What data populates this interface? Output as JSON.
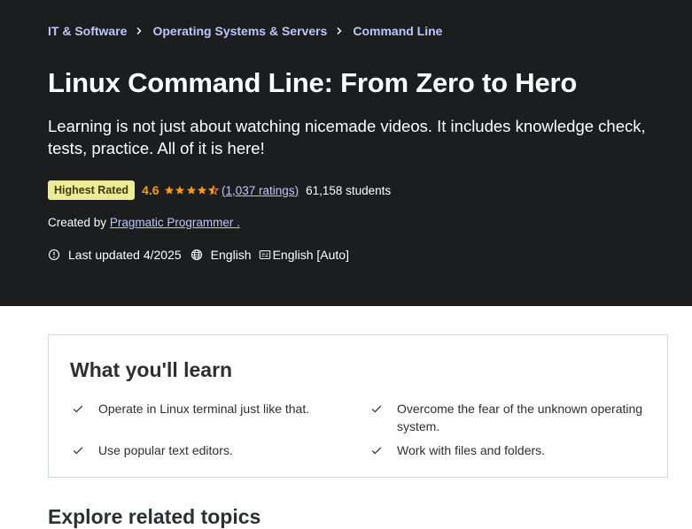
{
  "breadcrumb": [
    {
      "label": "IT & Software"
    },
    {
      "label": "Operating Systems & Servers"
    },
    {
      "label": "Command Line"
    }
  ],
  "course": {
    "title": "Linux Command Line: From Zero to Hero",
    "subtitle": "Learning is not just about watching nicemade videos. It includes knowledge check, tests, practice. All of it is here!",
    "badge": "Highest Rated",
    "rating": "4.6",
    "ratings_count": "(1,037 ratings)",
    "students": "61,158 students",
    "created_by_label": "Created by",
    "instructor": "Pragmatic Programmer .",
    "last_updated": "Last updated 4/2025",
    "language": "English",
    "captions": "English [Auto]"
  },
  "learn": {
    "title": "What you'll learn",
    "items": [
      "Operate in Linux terminal just like that.",
      "Overcome the fear of the unknown operating system.",
      "Use popular text editors.",
      "Work with files and folders."
    ]
  },
  "explore": {
    "title": "Explore related topics"
  },
  "colors": {
    "hero_bg": "#1c1d1f",
    "link": "#c0c4fc",
    "star": "#f69c08",
    "badge_bg": "#eceb98",
    "badge_text": "#3d3c0a"
  },
  "icons": {
    "breadcrumb_separator": "chevron-right-icon",
    "rating": "star-icon",
    "updated": "alert-clock-icon",
    "language": "globe-icon",
    "captions": "closed-captions-icon",
    "learn_item": "check-icon"
  }
}
